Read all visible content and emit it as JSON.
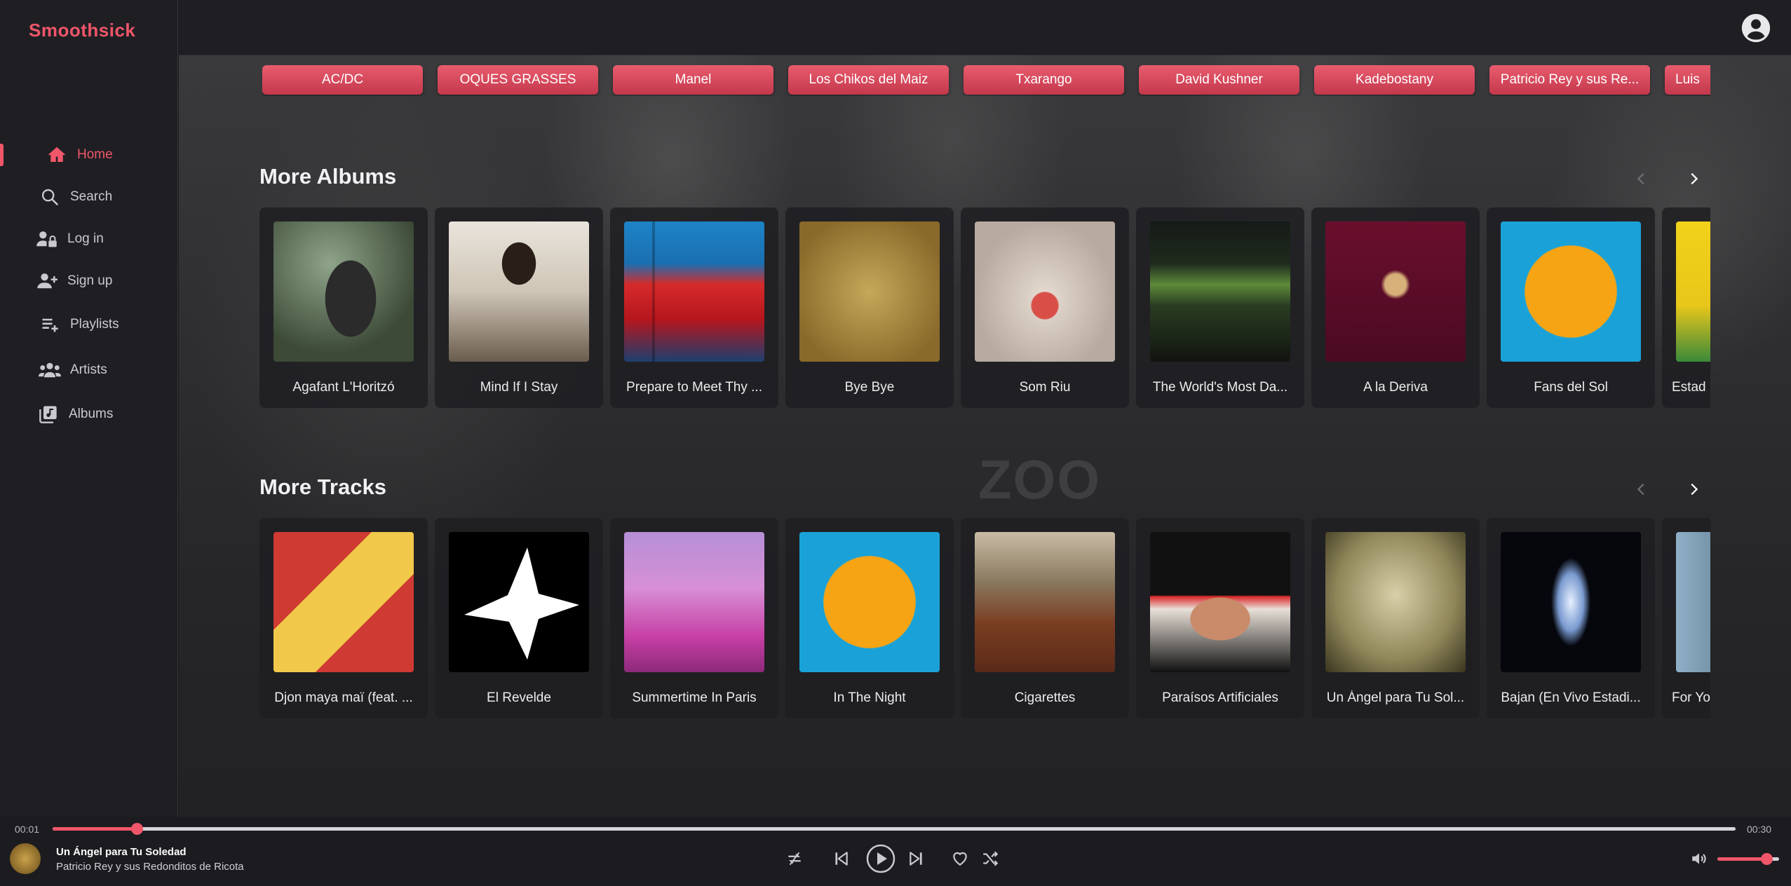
{
  "app": {
    "name": "Smoothsick",
    "accent": "#f0566a"
  },
  "sidebar": {
    "items": [
      {
        "label": "Home",
        "icon": "home-icon",
        "active": true
      },
      {
        "label": "Search",
        "icon": "search-icon",
        "active": false
      },
      {
        "label": "Log in",
        "icon": "user-lock-icon",
        "active": false
      },
      {
        "label": "Sign up",
        "icon": "user-plus-icon",
        "active": false
      },
      {
        "label": "Playlists",
        "icon": "playlist-add-icon",
        "active": false
      },
      {
        "label": "Artists",
        "icon": "group-icon",
        "active": false
      },
      {
        "label": "Albums",
        "icon": "library-music-icon",
        "active": false
      }
    ]
  },
  "header": {
    "avatar_icon": "account-circle-icon"
  },
  "artist_chips": [
    "AC/DC",
    "OQUES GRASSES",
    "Manel",
    "Los Chikos del Maiz",
    "Txarango",
    "David Kushner",
    "Kadebostany",
    "Patricio Rey y sus Re...",
    "Luis"
  ],
  "albums": {
    "title": "More Albums",
    "items": [
      {
        "title": "Agafant L'Horitzó"
      },
      {
        "title": "Mind If I Stay"
      },
      {
        "title": "Prepare to Meet Thy ..."
      },
      {
        "title": "Bye Bye"
      },
      {
        "title": "Som Riu"
      },
      {
        "title": "The World's Most Da..."
      },
      {
        "title": "A la Deriva"
      },
      {
        "title": "Fans del Sol"
      },
      {
        "title": "Estad"
      }
    ]
  },
  "tracks": {
    "title": "More Tracks",
    "items": [
      {
        "title": "Djon maya maï (feat. ..."
      },
      {
        "title": "El Revelde"
      },
      {
        "title": "Summertime In Paris"
      },
      {
        "title": "In The Night"
      },
      {
        "title": "Cigarettes"
      },
      {
        "title": "Paraísos Artificiales"
      },
      {
        "title": "Un Ángel para Tu Sol..."
      },
      {
        "title": "Bajan (En Vivo Estadi..."
      },
      {
        "title": "For Yo"
      }
    ]
  },
  "player": {
    "current_time": "00:01",
    "duration": "00:30",
    "progress": 0.05,
    "volume": 0.8,
    "track_title": "Un Ángel para Tu Soledad",
    "artist": "Patricio Rey y sus Redonditos de Ricota"
  }
}
